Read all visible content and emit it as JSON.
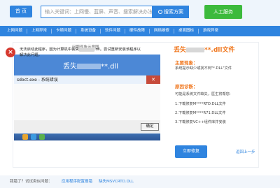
{
  "header": {
    "home_label": "首 页",
    "search_placeholder": "输入关键词：上网慢、蓝屏、声音、搜索解决办法",
    "search_button": "搜索方案",
    "service_button": "人工服务"
  },
  "nav": {
    "items": [
      "上网问题",
      "上网异常",
      "卡顿问题",
      "系统设备",
      "软件问题",
      "硬件故障",
      "网络维修",
      "桌面图标",
      "游戏异常"
    ]
  },
  "screenshot": {
    "caption": "问题现象示意图",
    "big_title_prefix": "丢失",
    "big_title_suffix": "**.dll",
    "window_title": "sdoct.exe - 系统错误",
    "close_symbol": "✕",
    "error_symbol": "×",
    "message_part1": "无法启动此程序，因为计算机中丢失",
    "message_part2": ".dll。尝试重新安装该程序以解决此问题。",
    "ok_button": "确定"
  },
  "info": {
    "title_prefix": "丢失",
    "title_suffix": "**.dll文件",
    "symptom_heading": "主要现象：",
    "symptom_text": "系统提示缺少或找不到\"*.DLL\"文件",
    "cause_heading": "原因诊断：",
    "cause_intro": "可能是系统文件缺失，医生将帮您:",
    "steps": [
      "1.下载修复M****RTD.DLL文件",
      "2.下载修复M****R71.DLL文件",
      "3.下载修复VC++组件库并安装"
    ]
  },
  "actions": {
    "fix_button": "立即修复",
    "prev_link": "返回上一步"
  },
  "footer": {
    "label": "我错了？试试类似问题：",
    "links": [
      "应用程序配置报错",
      "缺失MSVCRTD.DLL"
    ]
  },
  "colors": {
    "brand_blue": "#2f84df",
    "accent_orange": "#f07820",
    "service_green": "#3cba3c"
  }
}
